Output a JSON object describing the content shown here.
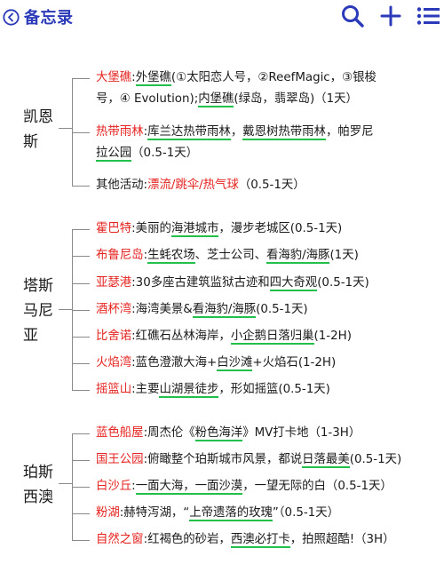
{
  "header": {
    "back_label": "备忘录",
    "accent_color": "#2b3ab8",
    "icons": [
      "back-icon",
      "search-icon",
      "add-icon",
      "list-icon"
    ]
  },
  "colors": {
    "highlight_red": "#e5231f",
    "underline_green": "#22c04a"
  },
  "groups": [
    {
      "title": "凯恩斯",
      "items": [
        {
          "lines": [
            [
              {
                "t": "大堡礁",
                "s": "red"
              },
              {
                "t": ":"
              },
              {
                "t": "外堡礁",
                "s": "ul"
              },
              {
                "t": "(①太阳恋人号，②ReefMagic，③银梭"
              }
            ],
            [
              {
                "t": "号，④ Evolution);"
              },
              {
                "t": "内堡礁",
                "s": "ul"
              },
              {
                "t": "(绿岛，翡翠岛)（1天）"
              }
            ]
          ]
        },
        {
          "lines": [
            [
              {
                "t": "热带雨林",
                "s": "red"
              },
              {
                "t": ":"
              },
              {
                "t": "库兰达热带雨林",
                "s": "ul"
              },
              {
                "t": "，"
              },
              {
                "t": "戴恩树热带雨林",
                "s": "ul"
              },
              {
                "t": "，帕罗尼"
              }
            ],
            [
              {
                "t": "拉公园",
                "s": "ul"
              },
              {
                "t": "（0.5-1天）"
              }
            ]
          ]
        },
        {
          "lines": [
            [
              {
                "t": "其他活动:"
              },
              {
                "t": "漂流/跳伞/热气球",
                "s": "red"
              },
              {
                "t": "（0.5-1天）"
              }
            ]
          ]
        }
      ]
    },
    {
      "title": "塔斯马尼亚",
      "items": [
        {
          "lines": [
            [
              {
                "t": "霍巴特",
                "s": "red"
              },
              {
                "t": ":美丽的"
              },
              {
                "t": "海港城市",
                "s": "ul"
              },
              {
                "t": "，漫步老城区(0.5-1天)"
              }
            ]
          ]
        },
        {
          "lines": [
            [
              {
                "t": "布鲁尼岛",
                "s": "red"
              },
              {
                "t": ":"
              },
              {
                "t": "生蚝农场",
                "s": "ul"
              },
              {
                "t": "、芝士公司、"
              },
              {
                "t": "看海豹/海豚",
                "s": "ul"
              },
              {
                "t": "(1天)"
              }
            ]
          ]
        },
        {
          "lines": [
            [
              {
                "t": "亚瑟港",
                "s": "red"
              },
              {
                "t": ":30多座古建筑监狱古迹和"
              },
              {
                "t": "四大奇观",
                "s": "ul"
              },
              {
                "t": "(0.5-1天)"
              }
            ]
          ]
        },
        {
          "lines": [
            [
              {
                "t": "酒杯湾",
                "s": "red"
              },
              {
                "t": ":海湾美景&"
              },
              {
                "t": "看海豹/海豚",
                "s": "ul"
              },
              {
                "t": "(0.5-1天)"
              }
            ]
          ]
        },
        {
          "lines": [
            [
              {
                "t": "比舍诺",
                "s": "red"
              },
              {
                "t": ":红礁石丛林海岸，"
              },
              {
                "t": "小企鹅日落归巢",
                "s": "ul"
              },
              {
                "t": "(1-2H)"
              }
            ]
          ]
        },
        {
          "lines": [
            [
              {
                "t": "火焰湾",
                "s": "red"
              },
              {
                "t": ":蓝色澄澈大海+"
              },
              {
                "t": "白沙滩",
                "s": "ul"
              },
              {
                "t": "+火焰石(1-2H)"
              }
            ]
          ]
        },
        {
          "lines": [
            [
              {
                "t": "摇篮山",
                "s": "red"
              },
              {
                "t": ":主要"
              },
              {
                "t": "山湖景徒步",
                "s": "ul"
              },
              {
                "t": "，形如摇篮(0.5-1天)"
              }
            ]
          ]
        }
      ]
    },
    {
      "title": "珀斯西澳",
      "items": [
        {
          "lines": [
            [
              {
                "t": "蓝色船屋",
                "s": "red"
              },
              {
                "t": ":周杰伦《"
              },
              {
                "t": "粉色海洋",
                "s": "ul"
              },
              {
                "t": "》MV打卡地（1-3H）"
              }
            ]
          ]
        },
        {
          "lines": [
            [
              {
                "t": "国王公园",
                "s": "red"
              },
              {
                "t": ":俯瞰整个珀斯城市风景，都说"
              },
              {
                "t": "日落最美",
                "s": "ul"
              },
              {
                "t": "(0.5-1天)"
              }
            ]
          ]
        },
        {
          "lines": [
            [
              {
                "t": "白沙丘",
                "s": "red"
              },
              {
                "t": ":"
              },
              {
                "t": "一面大海，一面沙漠",
                "s": "ul"
              },
              {
                "t": "，一望无际的白（0.5-1天）"
              }
            ]
          ]
        },
        {
          "lines": [
            [
              {
                "t": "粉湖",
                "s": "red"
              },
              {
                "t": ":赫特泻湖，“"
              },
              {
                "t": "上帝遗落的玫瑰",
                "s": "ul"
              },
              {
                "t": "”（0.5-1天）"
              }
            ]
          ]
        },
        {
          "lines": [
            [
              {
                "t": "自然之窗",
                "s": "red"
              },
              {
                "t": ":红褐色的砂岩，"
              },
              {
                "t": "西澳必打卡",
                "s": "ul"
              },
              {
                "t": "，拍照超酷!（3H）"
              }
            ]
          ]
        }
      ]
    }
  ]
}
